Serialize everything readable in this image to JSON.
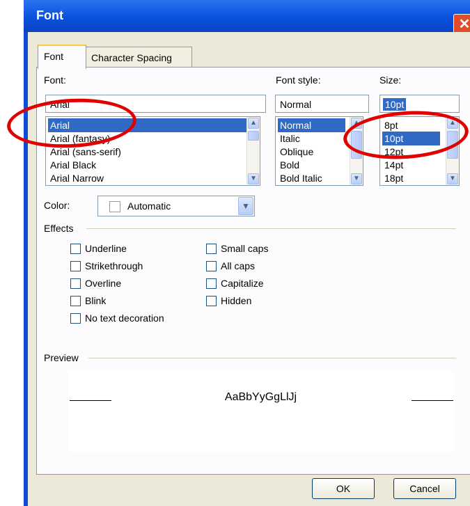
{
  "window": {
    "title": "Font",
    "close_glyph": "✕"
  },
  "tabs": [
    {
      "label": "Font",
      "active": true
    },
    {
      "label": "Character Spacing",
      "active": false
    }
  ],
  "font": {
    "label": "Font:",
    "value": "Arial",
    "list": [
      "Arial",
      "Arial (fantasy)",
      "Arial (sans-serif)",
      "Arial Black",
      "Arial Narrow"
    ],
    "selected": "Arial"
  },
  "style": {
    "label": "Font style:",
    "value": "Normal",
    "list": [
      "Normal",
      "Italic",
      "Oblique",
      "Bold",
      "Bold Italic"
    ],
    "selected": "Normal"
  },
  "size": {
    "label": "Size:",
    "value": "10pt",
    "list": [
      "8pt",
      "10pt",
      "12pt",
      "14pt",
      "18pt"
    ],
    "selected": "10pt"
  },
  "color": {
    "label": "Color:",
    "value": "Automatic"
  },
  "effects": {
    "label": "Effects",
    "left": [
      "Underline",
      "Strikethrough",
      "Overline",
      "Blink",
      "No text decoration"
    ],
    "right": [
      "Small caps",
      "All caps",
      "Capitalize",
      "Hidden"
    ]
  },
  "preview": {
    "label": "Preview",
    "sample": "AaBbYyGgLlJj"
  },
  "buttons": {
    "ok": "OK",
    "cancel": "Cancel"
  },
  "icons": {
    "scroll_up": "▲",
    "scroll_down": "▼",
    "dropdown": "chevron-down-icon"
  },
  "colors": {
    "selection": "#316ac5",
    "highlight_circle": "#e00000",
    "titlebar": "#0a50dc"
  }
}
